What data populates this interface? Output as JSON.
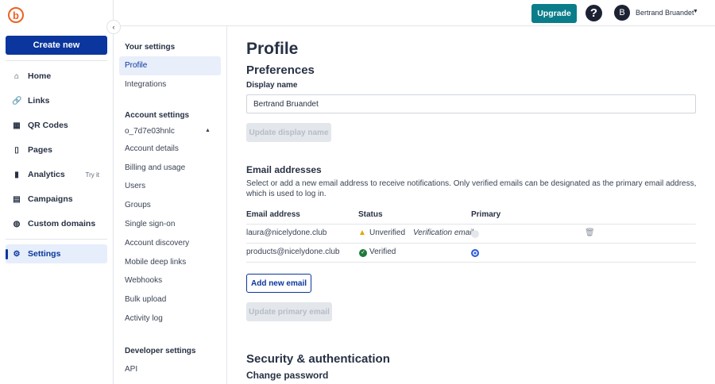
{
  "nav": {
    "create_label": "Create new",
    "collapse_icon": "‹",
    "items": [
      {
        "label": "Home",
        "icon": "⌂"
      },
      {
        "label": "Links",
        "icon": "🔗"
      },
      {
        "label": "QR Codes",
        "icon": "▦"
      },
      {
        "label": "Pages",
        "icon": "▯"
      },
      {
        "label": "Analytics",
        "icon": "▮",
        "badge": "Try it"
      },
      {
        "label": "Campaigns",
        "icon": "▤"
      },
      {
        "label": "Custom domains",
        "icon": "◍"
      },
      {
        "label": "Settings",
        "icon": "⚙"
      }
    ]
  },
  "topbar": {
    "upgrade_label": "Upgrade",
    "help_icon": "?",
    "avatar_initial": "B",
    "user_name": "Bertrand Bruandet"
  },
  "settings_nav": {
    "your_settings": "Your settings",
    "your_items": [
      "Profile",
      "Integrations"
    ],
    "account_settings": "Account settings",
    "account_id": "o_7d7e03hnlc",
    "account_items": [
      "Account details",
      "Billing and usage",
      "Users",
      "Groups",
      "Single sign-on",
      "Account discovery",
      "Mobile deep links",
      "Webhooks",
      "Bulk upload",
      "Activity log"
    ],
    "developer_settings": "Developer settings",
    "developer_items": [
      "API"
    ]
  },
  "main": {
    "title": "Profile",
    "preferences": "Preferences",
    "display_name_label": "Display name",
    "display_name_value": "Bertrand Bruandet",
    "update_display_name": "Update display name",
    "email_heading": "Email addresses",
    "email_desc": "Select or add a new email address to receive notifications. Only verified emails can be designated as the primary email address, which is used to log in.",
    "columns": [
      "Email address",
      "Status",
      "Primary"
    ],
    "emails": [
      {
        "email": "laura@nicelydone.club",
        "status": "Unverified",
        "note": "Verification email",
        "primary": false
      },
      {
        "email": "products@nicelydone.club",
        "status": "Verified",
        "primary": true
      }
    ],
    "add_email": "Add new email",
    "update_primary": "Update primary email",
    "security_heading": "Security & authentication",
    "change_password": "Change password"
  },
  "colors": {
    "brand": "#0a369d",
    "upgrade": "#0b7d8a",
    "logo": "#ee6123"
  }
}
